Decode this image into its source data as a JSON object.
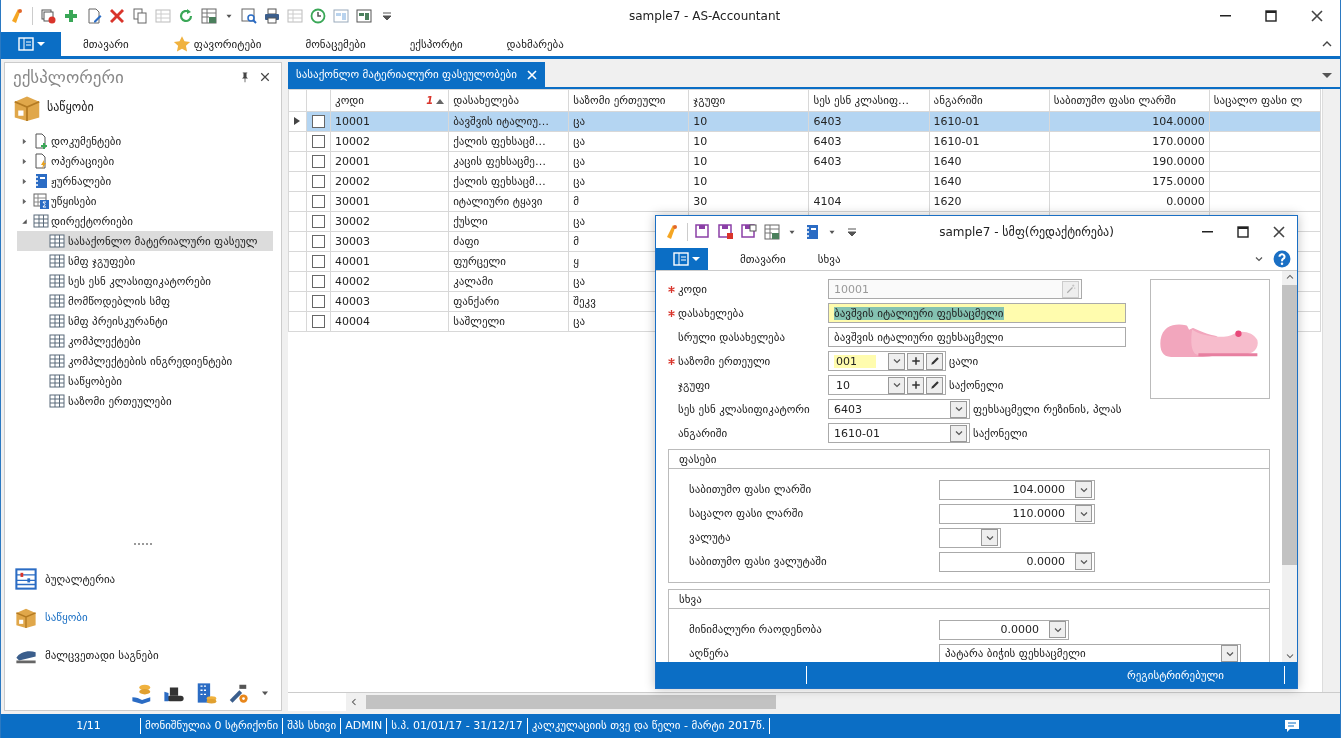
{
  "window": {
    "title": "sample7 - AS-Accountant"
  },
  "menu": {
    "tabs": [
      {
        "label": "მთავარი",
        "kind": "plain"
      },
      {
        "label": "ფავორიტები",
        "kind": "starred"
      },
      {
        "label": "მონაცემები",
        "kind": "plain"
      },
      {
        "label": "ექსპორტი",
        "kind": "plain"
      },
      {
        "label": "დახმარება",
        "kind": "plain"
      }
    ]
  },
  "explorer": {
    "title": "ექსპლორერი",
    "section": "საწყობი",
    "tree": [
      {
        "label": "დოკუმენტები",
        "kind": "document-add",
        "expanded": false,
        "selected": false
      },
      {
        "label": "ოპერაციები",
        "kind": "document-bolt",
        "expanded": false,
        "selected": false
      },
      {
        "label": "ჟურნალები",
        "kind": "journal",
        "expanded": false,
        "selected": false
      },
      {
        "label": "უწყისები",
        "kind": "report",
        "expanded": false,
        "selected": false
      },
      {
        "label": "დირექტორიები",
        "kind": "table",
        "expanded": true,
        "selected": false,
        "children": [
          {
            "label": "სასაქონლო მატერიალური ფასეულ",
            "selected": true
          },
          {
            "label": "სმფ ჯგუფები",
            "selected": false
          },
          {
            "label": "სეს ესნ კლასიფიკატორები",
            "selected": false
          },
          {
            "label": "მომწოდებლის სმფ",
            "selected": false
          },
          {
            "label": "სმფ პრეისკურანტი",
            "selected": false
          },
          {
            "label": "კომპლექტები",
            "selected": false
          },
          {
            "label": "კომპლექტების ინგრედიენტები",
            "selected": false
          },
          {
            "label": "საწყობები",
            "selected": false
          },
          {
            "label": "საზომი ერთეულები",
            "selected": false
          }
        ]
      }
    ],
    "modules": [
      {
        "label": "ბუღალტერია",
        "kind": "accounting",
        "selected": false
      },
      {
        "label": "საწყობი",
        "kind": "warehouse",
        "selected": true
      },
      {
        "label": "მალცვეთადი საგნები",
        "kind": "stapler",
        "selected": false
      }
    ]
  },
  "document_tab": {
    "title": "სასაქონლო მატერიალური ფასეულობები"
  },
  "table": {
    "columns": [
      {
        "label": "კოდი",
        "kind": "text",
        "sort_order": "1"
      },
      {
        "label": "დასახელება",
        "kind": "text"
      },
      {
        "label": "საზომი ერთეული",
        "kind": "text"
      },
      {
        "label": "ჯგუფი",
        "kind": "text"
      },
      {
        "label": "სეს ესნ კლასიფ…",
        "kind": "text"
      },
      {
        "label": "ანგარიში",
        "kind": "text"
      },
      {
        "label": "საბითუმო ფასი ლარში",
        "kind": "number"
      },
      {
        "label": "საცალო ფასი ლ",
        "kind": "number"
      }
    ],
    "rows": [
      {
        "selected": true,
        "checked": false,
        "cells": [
          "10001",
          "ბავშვის იტალიუ…",
          "ცა",
          "10",
          "6403",
          "1610-01",
          "104.0000"
        ]
      },
      {
        "selected": false,
        "checked": false,
        "cells": [
          "10002",
          "ქალის ფეხსაცმ…",
          "ცა",
          "10",
          "6403",
          "1610-01",
          "170.0000"
        ]
      },
      {
        "selected": false,
        "checked": false,
        "cells": [
          "20001",
          "კაცის ფეხსაცმე…",
          "ცა",
          "10",
          "6403",
          "1640",
          "190.0000"
        ]
      },
      {
        "selected": false,
        "checked": false,
        "cells": [
          "20002",
          "ქალის ფეხსაცმ…",
          "ცა",
          "10",
          null,
          "1640",
          "175.0000"
        ]
      },
      {
        "selected": false,
        "checked": false,
        "cells": [
          "30001",
          "იტალიური ტყავი",
          "მ",
          "30",
          "4104",
          "1620",
          "0.0000"
        ]
      },
      {
        "selected": false,
        "checked": false,
        "cells": [
          "30002",
          "ქუსლი",
          "ცა"
        ]
      },
      {
        "selected": false,
        "checked": false,
        "cells": [
          "30003",
          "ძაფი",
          "მ"
        ]
      },
      {
        "selected": false,
        "checked": false,
        "cells": [
          "40001",
          "ფურცელი",
          "ყ"
        ]
      },
      {
        "selected": false,
        "checked": false,
        "cells": [
          "40002",
          "კალამი",
          "ცა"
        ]
      },
      {
        "selected": false,
        "checked": false,
        "cells": [
          "40003",
          "ფანქარი",
          "შეკვ"
        ]
      },
      {
        "selected": false,
        "checked": false,
        "cells": [
          "40004",
          "საშლელი",
          "ცა"
        ]
      }
    ]
  },
  "dialog": {
    "title": "sample7 - სმფ(რედაქტირება)",
    "tabs": [
      "მთავარი",
      "სხვა"
    ],
    "fields": [
      {
        "label": "კოდი",
        "kind": "code",
        "required": true,
        "disabled": true,
        "highlighted": false,
        "value": "10001"
      },
      {
        "label": "დასახელება",
        "kind": "text",
        "required": true,
        "disabled": false,
        "highlighted": true,
        "text_selected": true,
        "value": "ბავშვის იტალიური ფეხსაცმელი"
      },
      {
        "label": "სრული დასახელება",
        "kind": "text",
        "required": false,
        "disabled": false,
        "highlighted": false,
        "value": "ბავშვის იტალიური ფეხსაცმელი"
      },
      {
        "label": "საზომი ერთეული",
        "kind": "lookup",
        "required": true,
        "disabled": false,
        "highlighted": true,
        "value": "001",
        "caption": "ცალი"
      },
      {
        "label": "ჯგუფი",
        "kind": "lookup",
        "required": false,
        "disabled": false,
        "highlighted": false,
        "value": "10",
        "caption": "საქონელი"
      },
      {
        "label": "სეს ესნ კლასიფიკატორი",
        "kind": "dropdown",
        "required": false,
        "disabled": false,
        "highlighted": false,
        "value": "6403",
        "caption": "ფეხსაცმელი რეზინის, პლას"
      },
      {
        "label": "ანგარიში",
        "kind": "dropdown",
        "required": false,
        "disabled": false,
        "highlighted": false,
        "value": "1610-01",
        "caption": "საქონელი"
      }
    ],
    "groups": [
      {
        "title": "ფასები",
        "fields": [
          {
            "label": "საბითუმო ფასი ლარში",
            "kind": "amount",
            "value": "104.0000"
          },
          {
            "label": "საცალო ფასი ლარში",
            "kind": "amount",
            "value": "110.0000"
          },
          {
            "label": "ვალუტა",
            "kind": "short"
          },
          {
            "label": "საბითუმო ფასი ვალუტაში",
            "kind": "amount",
            "value": "0.0000"
          }
        ]
      },
      {
        "title": "სხვა",
        "fields": [
          {
            "label": "მინიმალური რაოდენობა",
            "kind": "quantity",
            "value": "0.0000"
          },
          {
            "label": "აღწერა",
            "kind": "wide",
            "value": "პატარა ბიჭის ფეხსაცმელი"
          }
        ]
      }
    ],
    "status": "რეგისტრირებული"
  },
  "status_bar": [
    "1/11",
    "მონიშნულია 0 სტრიქონი",
    "შპს სხივი",
    "ADMIN",
    "ს.პ. 01/01/17 - 31/12/17",
    "კალკულაციის თვე და წელი - მარტი 2017წ."
  ]
}
